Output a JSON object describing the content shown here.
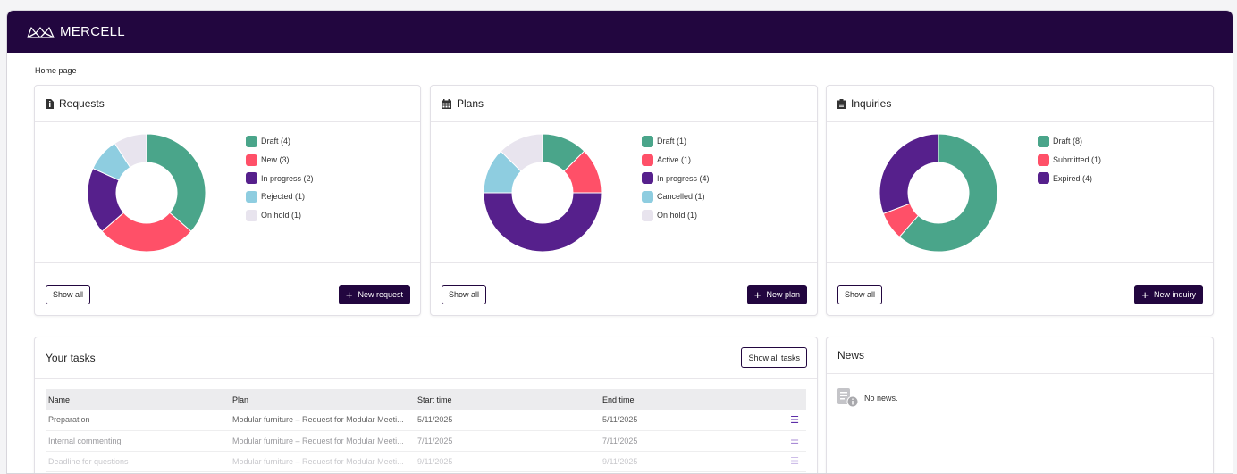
{
  "app": {
    "brand": "MERCELL"
  },
  "breadcrumb": "Home page",
  "colors": {
    "green": "#4aa58a",
    "pink": "#ff5068",
    "purple": "#56208c",
    "lightblue": "#8ecde0",
    "lavender": "#e8e4ee",
    "header": "#22063f"
  },
  "requests": {
    "title": "Requests",
    "legend": [
      {
        "label": "Draft (4)",
        "value": 4,
        "color": "#4aa58a"
      },
      {
        "label": "New (3)",
        "value": 3,
        "color": "#ff5068"
      },
      {
        "label": "In progress (2)",
        "value": 2,
        "color": "#56208c"
      },
      {
        "label": "Rejected (1)",
        "value": 1,
        "color": "#8ecde0"
      },
      {
        "label": "On hold (1)",
        "value": 1,
        "color": "#e8e4ee"
      }
    ],
    "show_all": "Show all",
    "new_button": "New request"
  },
  "plans": {
    "title": "Plans",
    "legend": [
      {
        "label": "Draft (1)",
        "value": 1,
        "color": "#4aa58a"
      },
      {
        "label": "Active (1)",
        "value": 1,
        "color": "#ff5068"
      },
      {
        "label": "In progress (4)",
        "value": 4,
        "color": "#56208c"
      },
      {
        "label": "Cancelled (1)",
        "value": 1,
        "color": "#8ecde0"
      },
      {
        "label": "On hold (1)",
        "value": 1,
        "color": "#e8e4ee"
      }
    ],
    "show_all": "Show all",
    "new_button": "New plan"
  },
  "inquiries": {
    "title": "Inquiries",
    "legend": [
      {
        "label": "Draft (8)",
        "value": 8,
        "color": "#4aa58a"
      },
      {
        "label": "Submitted (1)",
        "value": 1,
        "color": "#ff5068"
      },
      {
        "label": "Expired (4)",
        "value": 4,
        "color": "#56208c"
      }
    ],
    "show_all": "Show all",
    "new_button": "New inquiry"
  },
  "tasks": {
    "title": "Your tasks",
    "show_all": "Show all tasks",
    "columns": [
      "Name",
      "Plan",
      "Start time",
      "End time"
    ],
    "rows": [
      {
        "name": "Preparation",
        "plan": "Modular furniture – Request for Modular Meeti...",
        "start": "5/11/2025",
        "end": "5/11/2025"
      },
      {
        "name": "Internal commenting",
        "plan": "Modular furniture – Request for Modular Meeti...",
        "start": "7/11/2025",
        "end": "7/11/2025"
      },
      {
        "name": "Deadline for questions",
        "plan": "Modular furniture – Request for Modular Meeti...",
        "start": "9/11/2025",
        "end": "9/11/2025"
      }
    ]
  },
  "news": {
    "title": "News",
    "empty": "No news."
  }
}
